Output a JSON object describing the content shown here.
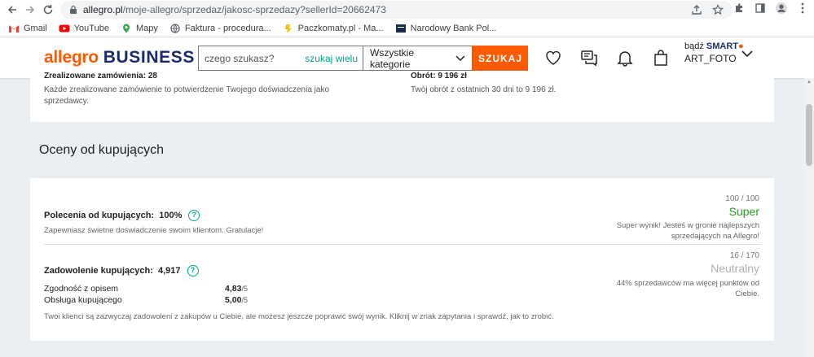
{
  "browser": {
    "url_host": "allegro.pl",
    "url_path": "/moje-allegro/sprzedaz/jakosc-sprzedazy?sellerId=20662473",
    "bookmarks": [
      {
        "label": "Gmail",
        "icon": "gmail-icon",
        "color": "#ea4335"
      },
      {
        "label": "YouTube",
        "icon": "youtube-icon",
        "color": "#ff0000"
      },
      {
        "label": "Mapy",
        "icon": "maps-icon",
        "color": "#34a853"
      },
      {
        "label": "Faktura - procedura...",
        "icon": "globe-icon",
        "color": "#5f6368"
      },
      {
        "label": "Paczkomaty.pl - Ma...",
        "icon": "paczkomaty-icon",
        "color": "#f4c20d"
      },
      {
        "label": "Narodowy Bank Pol...",
        "icon": "nbp-icon",
        "color": "#1a2b4d"
      }
    ]
  },
  "header": {
    "logo_main": "allegro",
    "logo_sub": "BUSINESS",
    "search_placeholder": "czego szukasz?",
    "search_multi": "szukaj wielu",
    "category": "Wszystkie kategorie",
    "search_button": "SZUKAJ",
    "account_prefix": "bądź",
    "account_smart": "SMART",
    "username": "ART_FOTO",
    "accent_color": "#ff5a00",
    "brand_color": "#1a2b6d"
  },
  "top_section": {
    "left_partial": "Zrealizowane zamówienia: 28",
    "left_desc": "Każde zrealizowane zamówienie to potwierdzenie Twojego doświadczenia jako sprzedawcy.",
    "right_partial": "Obrót: 9 196 zł",
    "right_desc": "Twój obrót z ostatnich 30 dni to 9 196 zł."
  },
  "ratings": {
    "title": "Oceny od kupujących",
    "recommendations": {
      "label": "Polecenia od kupujących:",
      "value": "100%",
      "desc": "Zapewniasz świetne doświadczenie swoim klientom. Gratulacje!",
      "score": "100 / 100",
      "status": "Super",
      "status_color": "#1ea01e",
      "status_desc": "Super wynik! Jesteś w gronie najlepszych sprzedających na Allegro!"
    },
    "satisfaction": {
      "label": "Zadowolenie kupujących:",
      "value": "4,917",
      "items": [
        {
          "label": "Zgodność z opisem",
          "value": "4,83",
          "max": "/5"
        },
        {
          "label": "Obsługa kupującego",
          "value": "5,00",
          "max": "/5"
        }
      ],
      "desc": "Twoi klienci są zazwyczaj zadowoleni z zakupów u Ciebie, ale możesz jeszcze poprawić swój wynik. Kliknij w znak zapytania i sprawdź, jak to zrobić.",
      "score": "16 / 170",
      "status": "Neutralny",
      "status_color": "#b0b0b0",
      "status_desc": "44% sprzedawców ma więcej punktów od Ciebie."
    }
  }
}
